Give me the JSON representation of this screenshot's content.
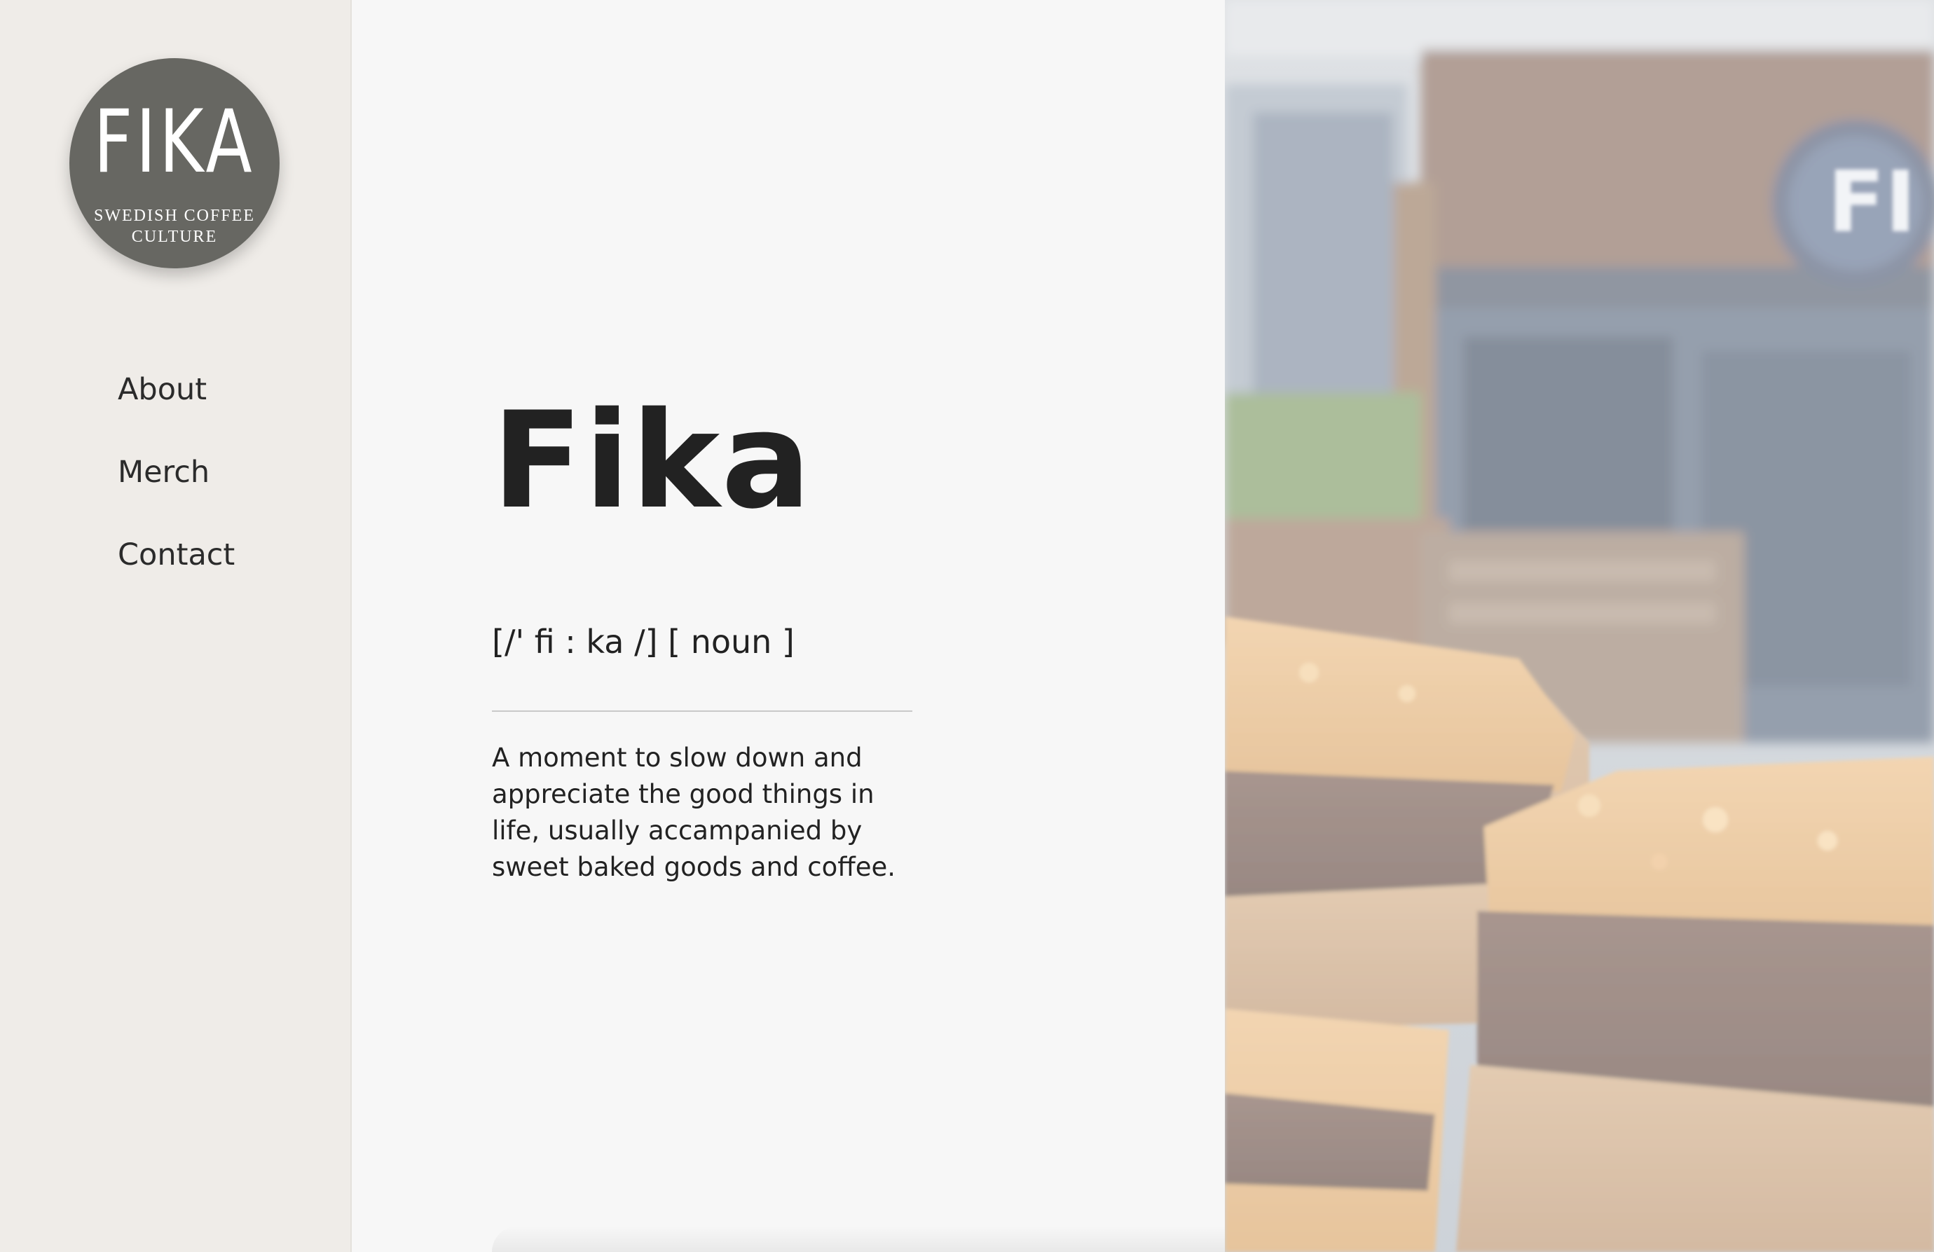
{
  "brand": {
    "logo_word": "FIKA",
    "logo_sub_line1": "SWEDISH COFFEE",
    "logo_sub_line2": "CULTURE",
    "logo_color": "#676762"
  },
  "nav": {
    "items": [
      {
        "label": "About"
      },
      {
        "label": "Merch"
      },
      {
        "label": "Contact"
      }
    ]
  },
  "main": {
    "title": "Fika",
    "pronunciation": "[/' fi : ka /] [ noun ]",
    "description": "A moment to slow down and appreciate the good things in life, usually accampanied by sweet baked goods and coffee."
  },
  "hero": {
    "storefront_sign_text": "FI"
  },
  "colors": {
    "sidebar_bg": "#efece8",
    "main_bg": "#f7f7f7",
    "text": "#222222"
  }
}
